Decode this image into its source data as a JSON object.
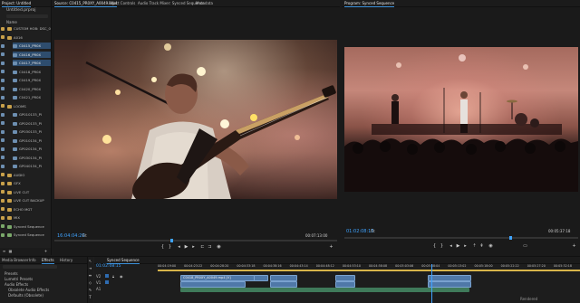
{
  "project": {
    "tab_label": "Project: Untitled",
    "file_label": "Untitled.prproj",
    "header": "Name",
    "items": [
      {
        "label": "CUSTOM HOB: DSC_0",
        "kind": "folder"
      },
      {
        "label": "A016",
        "kind": "folder"
      },
      {
        "label": "C0415_PR0X",
        "kind": "clip"
      },
      {
        "label": "C0416_PR0X",
        "kind": "clip"
      },
      {
        "label": "C0417_PR0X",
        "kind": "clip"
      },
      {
        "label": "C0418_PR0X",
        "kind": "clip"
      },
      {
        "label": "C0419_PR0X",
        "kind": "clip"
      },
      {
        "label": "C0420_PR0X",
        "kind": "clip"
      },
      {
        "label": "C0421_PR0X",
        "kind": "clip"
      },
      {
        "label": "LOOMS",
        "kind": "folder"
      },
      {
        "label": "GP010133_PI",
        "kind": "clip"
      },
      {
        "label": "GP020133_PI",
        "kind": "clip"
      },
      {
        "label": "GP030133_PI",
        "kind": "clip"
      },
      {
        "label": "GP010134_PI",
        "kind": "clip"
      },
      {
        "label": "GP020134_PI",
        "kind": "clip"
      },
      {
        "label": "GP030134_PI",
        "kind": "clip"
      },
      {
        "label": "GP040134_PI",
        "kind": "clip"
      },
      {
        "label": "AUDIO",
        "kind": "folder"
      },
      {
        "label": "GFX",
        "kind": "folder"
      },
      {
        "label": "LIVE CUT",
        "kind": "folder"
      },
      {
        "label": "LIVE CUT BACKUP",
        "kind": "folder"
      },
      {
        "label": "ECHO MGT",
        "kind": "folder"
      },
      {
        "label": "MIX",
        "kind": "folder"
      },
      {
        "label": "Synced Sequence",
        "kind": "seq"
      },
      {
        "label": "Synced Sequence",
        "kind": "seq"
      }
    ]
  },
  "source": {
    "tabs": [
      "Source: C0415_PR0XY_A0049.mp4",
      "Effect Controls",
      "Audio Track Mixer: Synced Sequence",
      "Metadata"
    ],
    "timecode_left": "16:04:04:20",
    "fit": "Fit",
    "timecode_right": "00:07:13:00"
  },
  "program": {
    "tab": "Program: Synced Sequence",
    "timecode_left": "01:02:08:15",
    "fit": "Fit",
    "timecode_right": "00:05:37:18"
  },
  "effects_panel": {
    "tabs": [
      "Media Browser",
      "Info",
      "Effects",
      "History"
    ],
    "items": [
      "Presets",
      "Lumetri Presets",
      "Audio Effects",
      "Obsolete Audio Effects",
      "Defaults (Obsolete)"
    ]
  },
  "timeline": {
    "tab": "Synced Sequence",
    "timecode": "01:02:08:15",
    "ruler": [
      "00:04:19:00",
      "00:04:23:22",
      "00:04:28:20",
      "00:04:33:18",
      "00:04:38:16",
      "00:04:43:14",
      "00:04:48:12",
      "00:04:53:10",
      "00:04:58:08",
      "00:05:03:06",
      "00:05:08:04",
      "00:05:13:02",
      "00:05:18:00",
      "00:05:22:22",
      "00:05:27:20",
      "00:05:32:18"
    ],
    "track_labels": [
      "V2",
      "V1",
      "A1"
    ],
    "clip_label": "C0418_PR0XY_A0049.mp4 [V]",
    "status": "Rendered"
  },
  "colors": {
    "accent": "#3a8fd8",
    "timecode": "#3fa3ff",
    "clip": "#4f78a8"
  }
}
